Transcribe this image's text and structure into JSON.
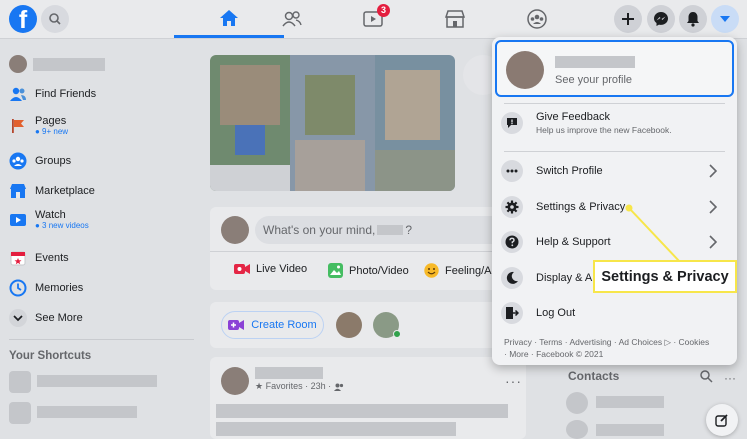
{
  "topbar": {
    "logo_letter": "f",
    "notification_count": "3"
  },
  "sidebar": {
    "items": [
      {
        "label": "Find Friends",
        "sub": "",
        "icon": "friends-icon"
      },
      {
        "label": "Pages",
        "sub": "● 9+ new",
        "icon": "flag-icon"
      },
      {
        "label": "Groups",
        "sub": "",
        "icon": "groups-icon"
      },
      {
        "label": "Marketplace",
        "sub": "",
        "icon": "marketplace-icon"
      },
      {
        "label": "Watch",
        "sub": "● 3 new videos",
        "icon": "watch-icon"
      },
      {
        "label": "Events",
        "sub": "",
        "icon": "calendar-icon"
      },
      {
        "label": "Memories",
        "sub": "",
        "icon": "clock-icon"
      },
      {
        "label": "See More",
        "sub": "",
        "icon": "chevron-down-icon"
      }
    ],
    "shortcuts_heading": "Your Shortcuts"
  },
  "composer": {
    "placeholder": "What's on your mind,",
    "placeholder_suffix": "?",
    "actions": [
      "Live Video",
      "Photo/Video",
      "Feeling/Ac"
    ]
  },
  "room": {
    "create_room": "Create Room"
  },
  "post": {
    "meta": "★ Favorites · 23h ·"
  },
  "contacts": {
    "heading": "Contacts"
  },
  "menu": {
    "see_profile": "See your profile",
    "give_feedback": "Give Feedback",
    "give_feedback_desc": "Help us improve the new Facebook.",
    "switch_profile": "Switch Profile",
    "settings_privacy": "Settings & Privacy",
    "help_support": "Help & Support",
    "display_access": "Display & A",
    "log_out": "Log Out",
    "footer_line1": "Privacy · Terms · Advertising · Ad Choices ▷ · Cookies",
    "footer_line2": "· More · Facebook © 2021"
  },
  "callout": {
    "text": "Settings & Privacy"
  },
  "colors": {
    "accent": "#1877f2",
    "callout_border": "#f7e64a"
  }
}
